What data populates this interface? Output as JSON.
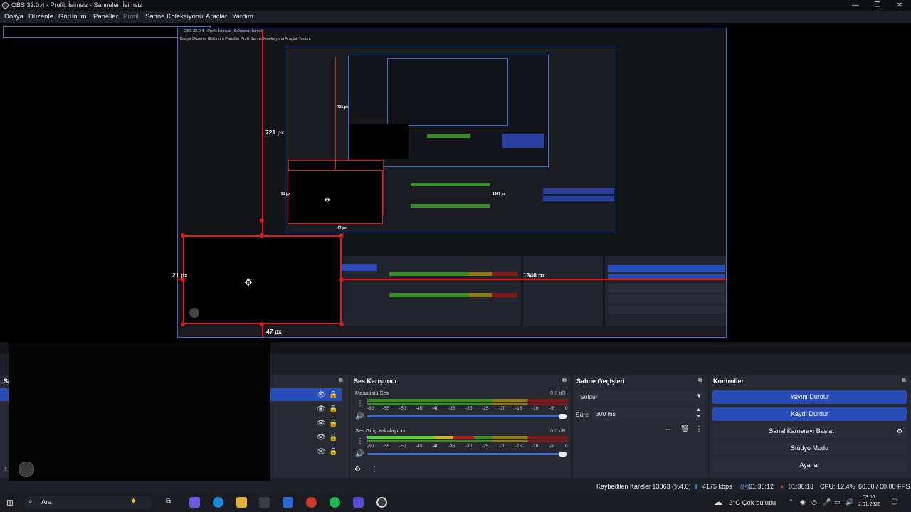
{
  "window": {
    "title": "OBS 32.0.4 - Profil: İsimsiz - Sahneler: İsimsiz",
    "minimize": "—",
    "maximize": "❐",
    "close": "✕"
  },
  "menu": {
    "items": [
      "Dosya",
      "Düzenle",
      "Görünüm",
      "Paneller",
      "Profil",
      "Sahne Koleksiyonu",
      "Araçlar",
      "Yardım"
    ]
  },
  "preview": {
    "nested_title": "OBS 32.0.4 - Profil: İsimsiz - Sahneler: İsimsiz",
    "nested_menu": "Dosya   Düzenle   Görünüm   Paneller   Profil   Sahne Koleksiyonu   Araçlar   Yardım",
    "dim_top": "721 px",
    "dim_left": "21 px",
    "dim_right": "1346 px",
    "dim_bottom": "47 px",
    "inner_dim_1": "721 px",
    "inner_dim_2": "47 px",
    "inner_dim_3": "21 px",
    "inner_dim_4": "1347 px"
  },
  "docks": {
    "scenes_header": "Sa",
    "sources_header": "",
    "mixer": {
      "header": "Ses Karıştırıcı",
      "tracks": [
        {
          "name": "Masaüstü Ses",
          "db": "0.0 dB"
        },
        {
          "name": "Ses Giriş Yakalayıcısı",
          "db": "0.0 dB"
        }
      ],
      "ticks": [
        "-60",
        "-55",
        "-50",
        "-45",
        "-40",
        "-35",
        "-30",
        "-25",
        "-20",
        "-15",
        "-10",
        "-5",
        "0"
      ]
    },
    "transitions": {
      "header": "Sahne Geçişleri",
      "selected": "Soldur",
      "duration_label": "Süre",
      "duration_value": "300 ms"
    },
    "controls": {
      "header": "Kontroller",
      "stop_stream": "Yayını Durdur",
      "stop_record": "Kaydı Durdur",
      "virtual_cam": "Sanal Kamerayı Başlat",
      "studio_mode": "Stüdyo Modu",
      "settings": "Ayarlar"
    }
  },
  "status": {
    "dropped_frames": "Kaybedilen Kareler 13863 (%4.0)",
    "bitrate": "4175 kbps",
    "stream_time": "01:36:12",
    "rec_time": "01:36:13",
    "cpu": "CPU: 12.4%",
    "fps": "60.00 / 60.00 FPS"
  },
  "taskbar": {
    "search_placeholder": "Ara",
    "weather": "2°C  Çok bulutlu",
    "time": "03:50",
    "date": "2.01.2026"
  },
  "colors": {
    "accent": "#284cb8",
    "guide_red": "#e01919",
    "background": "#1d1f26"
  }
}
